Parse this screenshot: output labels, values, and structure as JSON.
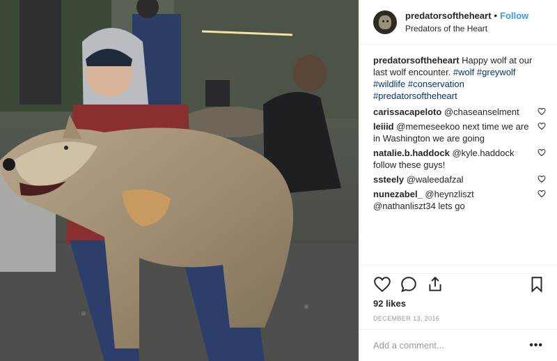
{
  "post": {
    "image_alt": "",
    "author": {
      "username": "predatorsoftheheart",
      "follow_label": "Follow",
      "location": "Predators of the Heart",
      "separator": "•"
    },
    "caption": {
      "username": "predatorsoftheheart",
      "text": "Happy wolf at our last wolf encounter.",
      "hashtags": [
        "#wolf",
        "#greywolf",
        "#wildlife",
        "#conservation",
        "#predatorsoftheheart"
      ]
    },
    "comments": [
      {
        "username": "carissacapeloto",
        "text": "@chaseanselment"
      },
      {
        "username": "leiiid",
        "text": "@memeseekoo next time we are in Washington we are going"
      },
      {
        "username": "natalie.b.haddock",
        "text": "@kyle.haddock follow these guys!"
      },
      {
        "username": "ssteely",
        "text": "@waleedafzal"
      },
      {
        "username": "nunezabel_",
        "text": "@heynzliszt @nathanliszt34 lets go"
      }
    ],
    "likes": "92 likes",
    "date": "DECEMBER 13, 2016",
    "comment_placeholder": "Add a comment...",
    "more_icon": "more-options-icon",
    "icons": [
      "heart-icon",
      "comment-icon",
      "share-icon",
      "bookmark-icon"
    ]
  }
}
